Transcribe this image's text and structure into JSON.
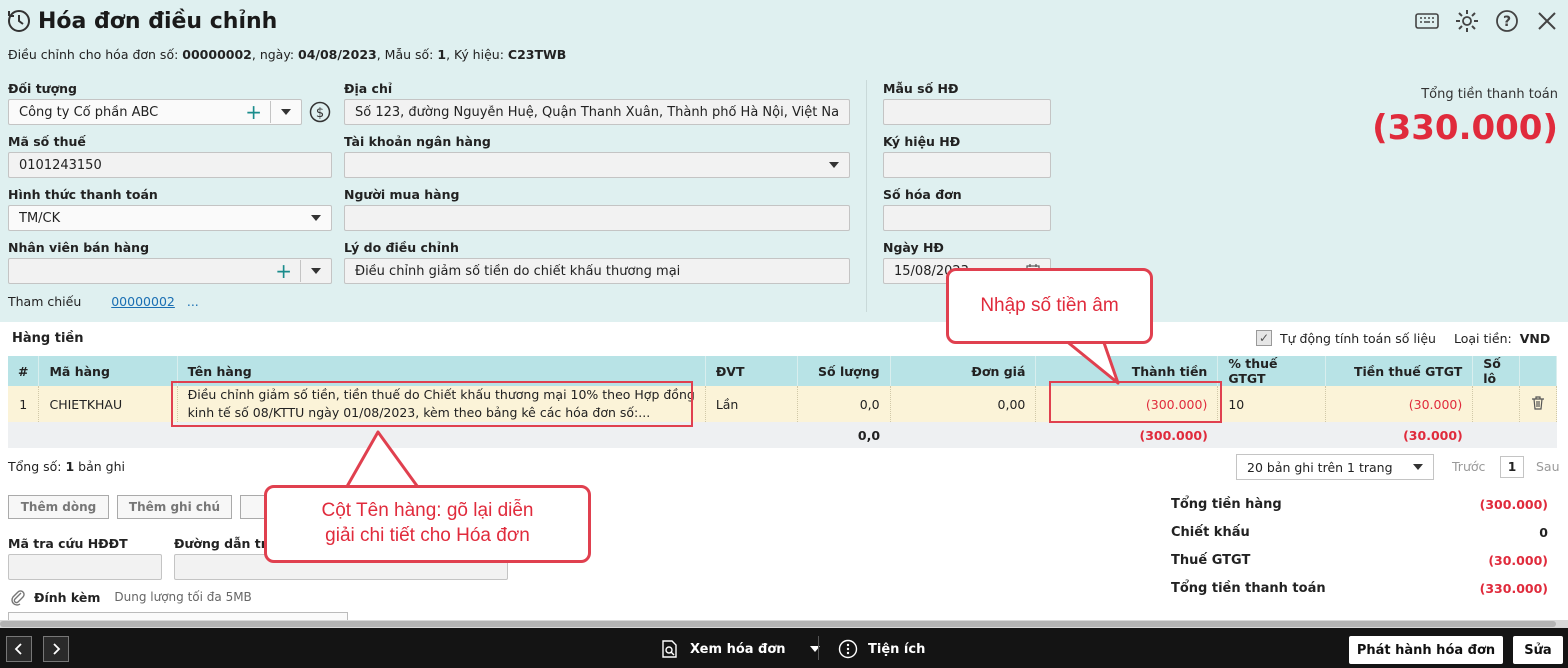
{
  "window": {
    "title": "Hóa đơn điều chỉnh",
    "subtitle_prefix": "Điều chỉnh cho hóa đơn số: ",
    "invoice_no": "00000002",
    "date_prefix": ", ngày: ",
    "date": "04/08/2023",
    "form_prefix": ", Mẫu số: ",
    "form_no": "1",
    "symbol_prefix": ", Ký hiệu: ",
    "symbol": "C23TWB"
  },
  "form": {
    "doi_tuong_label": "Đối tượng",
    "doi_tuong_value": "Công ty Cổ phần ABC",
    "dia_chi_label": "Địa chỉ",
    "dia_chi_value": "Số 123, đường Nguyễn Huệ, Quận Thanh Xuân, Thành phố Hà Nội, Việt Nam",
    "mau_so_label": "Mẫu số HĐ",
    "mau_so_value": "",
    "mst_label": "Mã số thuế",
    "mst_value": "0101243150",
    "tk_label": "Tài khoản ngân hàng",
    "tk_value": "",
    "ky_hieu_label": "Ký hiệu HĐ",
    "ky_hieu_value": "",
    "httt_label": "Hình thức thanh toán",
    "httt_value": "TM/CK",
    "nguoi_mua_label": "Người mua hàng",
    "nguoi_mua_value": "",
    "so_hd_label": "Số hóa đơn",
    "so_hd_value": "",
    "nvbh_label": "Nhân viên bán hàng",
    "nvbh_value": "",
    "ly_do_label": "Lý do điều chỉnh",
    "ly_do_value": "Điều chỉnh giảm số tiền do chiết khấu thương mại",
    "ngay_hd_label": "Ngày HĐ",
    "ngay_hd_value": "15/08/2023",
    "tham_chieu_label": "Tham chiếu",
    "tham_chieu_link": "00000002",
    "tham_chieu_more": "..."
  },
  "total": {
    "label": "Tổng tiền thanh toán",
    "value": "(330.000)"
  },
  "section": {
    "title": "Hàng tiền",
    "auto_calc": "Tự động tính toán số liệu",
    "currency_label": "Loại tiền:",
    "currency_value": "VND"
  },
  "table": {
    "headers": [
      "#",
      "Mã hàng",
      "Tên hàng",
      "ĐVT",
      "Số lượng",
      "Đơn giá",
      "Thành tiền",
      "% thuế GTGT",
      "Tiền thuế GTGT",
      "Số lô"
    ],
    "rows": [
      {
        "no": "1",
        "ma_hang": "CHIETKHAU",
        "ten_hang_1": "Điều chỉnh giảm số tiền, tiền thuế do Chiết khấu thương mại 10% theo Hợp đồng",
        "ten_hang_2": "kinh tế số 08/KTTU ngày 01/08/2023, kèm theo bảng kê các hóa đơn số:...",
        "dvt": "Lần",
        "so_luong": "0,0",
        "don_gia": "0,00",
        "thanh_tien": "(300.000)",
        "thue_pct": "10",
        "tien_thue": "(30.000)",
        "so_lo": ""
      }
    ],
    "summary": {
      "so_luong": "0,0",
      "thanh_tien": "(300.000)",
      "tien_thue": "(30.000)"
    }
  },
  "footer_info": {
    "count_prefix": "Tổng số: ",
    "count": "1",
    "count_suffix": " bản ghi",
    "pager_value": "20 bản ghi trên 1 trang",
    "prev": "Trước",
    "page": "1",
    "next": "Sau"
  },
  "actions": {
    "add_row": "Thêm dòng",
    "add_note": "Thêm ghi chú",
    "ma_tra_cuu_label": "Mã tra cứu HĐĐT",
    "duong_dan_label": "Đường dẫn tra",
    "attach_label": "Đính kèm",
    "attach_hint": "Dung lượng tối đa 5MB"
  },
  "summary": {
    "tong_tien_hang_label": "Tổng tiền hàng",
    "tong_tien_hang_value": "(300.000)",
    "chiet_khau_label": "Chiết khấu",
    "chiet_khau_value": "0",
    "thue_label": "Thuế GTGT",
    "thue_value": "(30.000)",
    "tong_tt_label": "Tổng tiền thanh toán",
    "tong_tt_value": "(330.000)"
  },
  "bottom_bar": {
    "view_invoice": "Xem hóa đơn",
    "utilities": "Tiện ích",
    "issue": "Phát hành hóa đơn",
    "edit": "Sửa"
  },
  "callouts": {
    "negative_amount": "Nhập số tiền âm",
    "item_name_line1": "Cột Tên hàng: gõ lại diễn",
    "item_name_line2": "giải chi tiết cho Hóa đơn"
  },
  "colors": {
    "accent_red": "#e02b3c",
    "header_bg": "#dff0f0",
    "table_header": "#b8e3e6",
    "row_bg": "#fbf3d8"
  }
}
